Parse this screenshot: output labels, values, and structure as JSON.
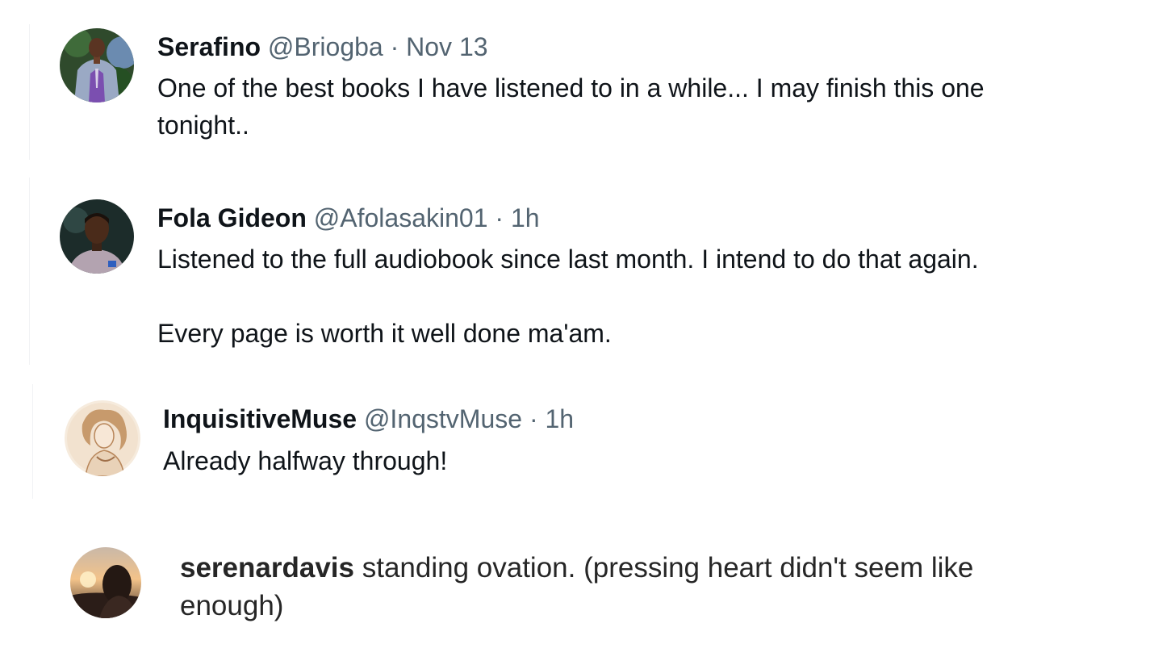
{
  "comments": [
    {
      "name": "Serafino",
      "handle": "@Briogba",
      "sep": "·",
      "time": "Nov 13",
      "text": "One of the best books I have listened to in a while... I may finish this one tonight..",
      "avatar_icon": "user-avatar-photo"
    },
    {
      "name": "Fola Gideon",
      "handle": "@Afolasakin01",
      "sep": "·",
      "time": "1h",
      "text_line1": "Listened to the full audiobook since last month. I intend to do that again.",
      "text_line2": "Every page is worth it well done ma'am.",
      "avatar_icon": "user-avatar-photo"
    },
    {
      "name": "InquisitiveMuse",
      "handle": "@InqstvMuse",
      "sep": "·",
      "time": "1h",
      "text": "Already halfway through!",
      "avatar_icon": "user-avatar-illustration"
    },
    {
      "username": "serenardavis",
      "text": "standing ovation. (pressing heart didn't seem like enough)",
      "avatar_icon": "user-avatar-photo"
    }
  ]
}
